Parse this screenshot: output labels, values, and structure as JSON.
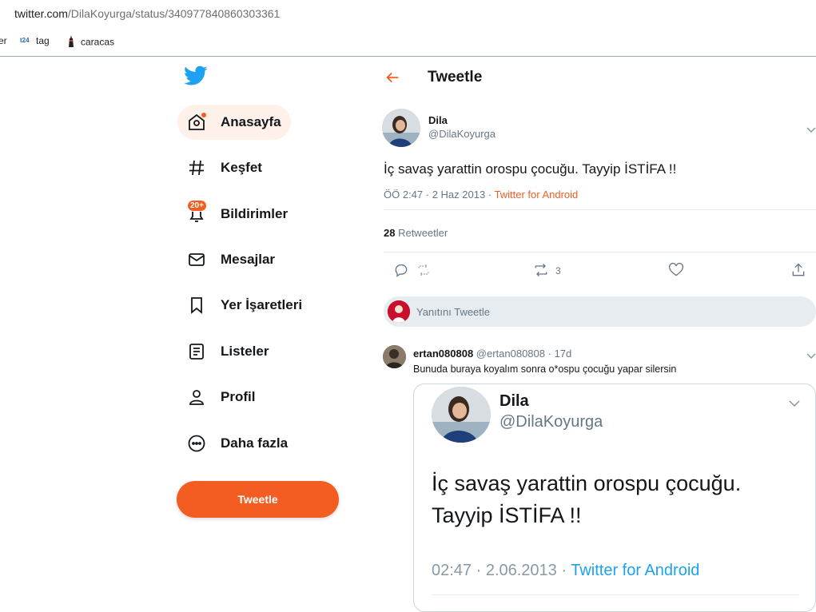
{
  "browser": {
    "url_host": "twitter.com",
    "url_path": "/DilaKoyurga/status/340977840860303361",
    "bookmarks": [
      {
        "label": "er",
        "icon": "bookmark-partial"
      },
      {
        "label": "tag",
        "icon": "t24-icon"
      },
      {
        "label": "caracas",
        "icon": "tower-icon"
      }
    ],
    "t24_text": "t24"
  },
  "nav": {
    "items": [
      {
        "label": "Anasayfa",
        "icon": "home-icon"
      },
      {
        "label": "Keşfet",
        "icon": "hashtag-icon"
      },
      {
        "label": "Bildirimler",
        "icon": "bell-icon",
        "badge": "20+"
      },
      {
        "label": "Mesajlar",
        "icon": "mail-icon"
      },
      {
        "label": "Yer İşaretleri",
        "icon": "bookmark-icon"
      },
      {
        "label": "Listeler",
        "icon": "list-icon"
      },
      {
        "label": "Profil",
        "icon": "profile-icon"
      },
      {
        "label": "Daha fazla",
        "icon": "more-icon"
      }
    ],
    "tweet_button": "Tweetle"
  },
  "header": {
    "title": "Tweetle"
  },
  "tweet": {
    "name": "Dila",
    "handle": "@DilaKoyurga",
    "text": "İç savaş yarattin orospu çocuğu. Tayyip İSTİFA !!",
    "time": "ÖÖ 2:47 · 2 Haz 2013 · ",
    "source": "Twitter for Android",
    "retweet_count": "28",
    "retweet_label": " Retweetler",
    "action_retweet_count": "3"
  },
  "reply_box": {
    "placeholder": "Yanıtını Tweetle"
  },
  "reply": {
    "name": "ertan080808",
    "handle_time": " @ertan080808 · 17d",
    "text": "Bunuda buraya koyalım sonra o*ospu çocuğu yapar silersin"
  },
  "card": {
    "name": "Dila",
    "handle": "@DilaKoyurga",
    "text": "İç savaş yarattin orospu çocuğu. Tayyip İSTİFA !!",
    "time": "02:47 · 2.06.2013 · ",
    "source": "Twitter for Android"
  },
  "colors": {
    "accent": "#f45d22",
    "link_blue": "#1da1f2",
    "muted": "#657786",
    "bird": "#1da1f2"
  }
}
